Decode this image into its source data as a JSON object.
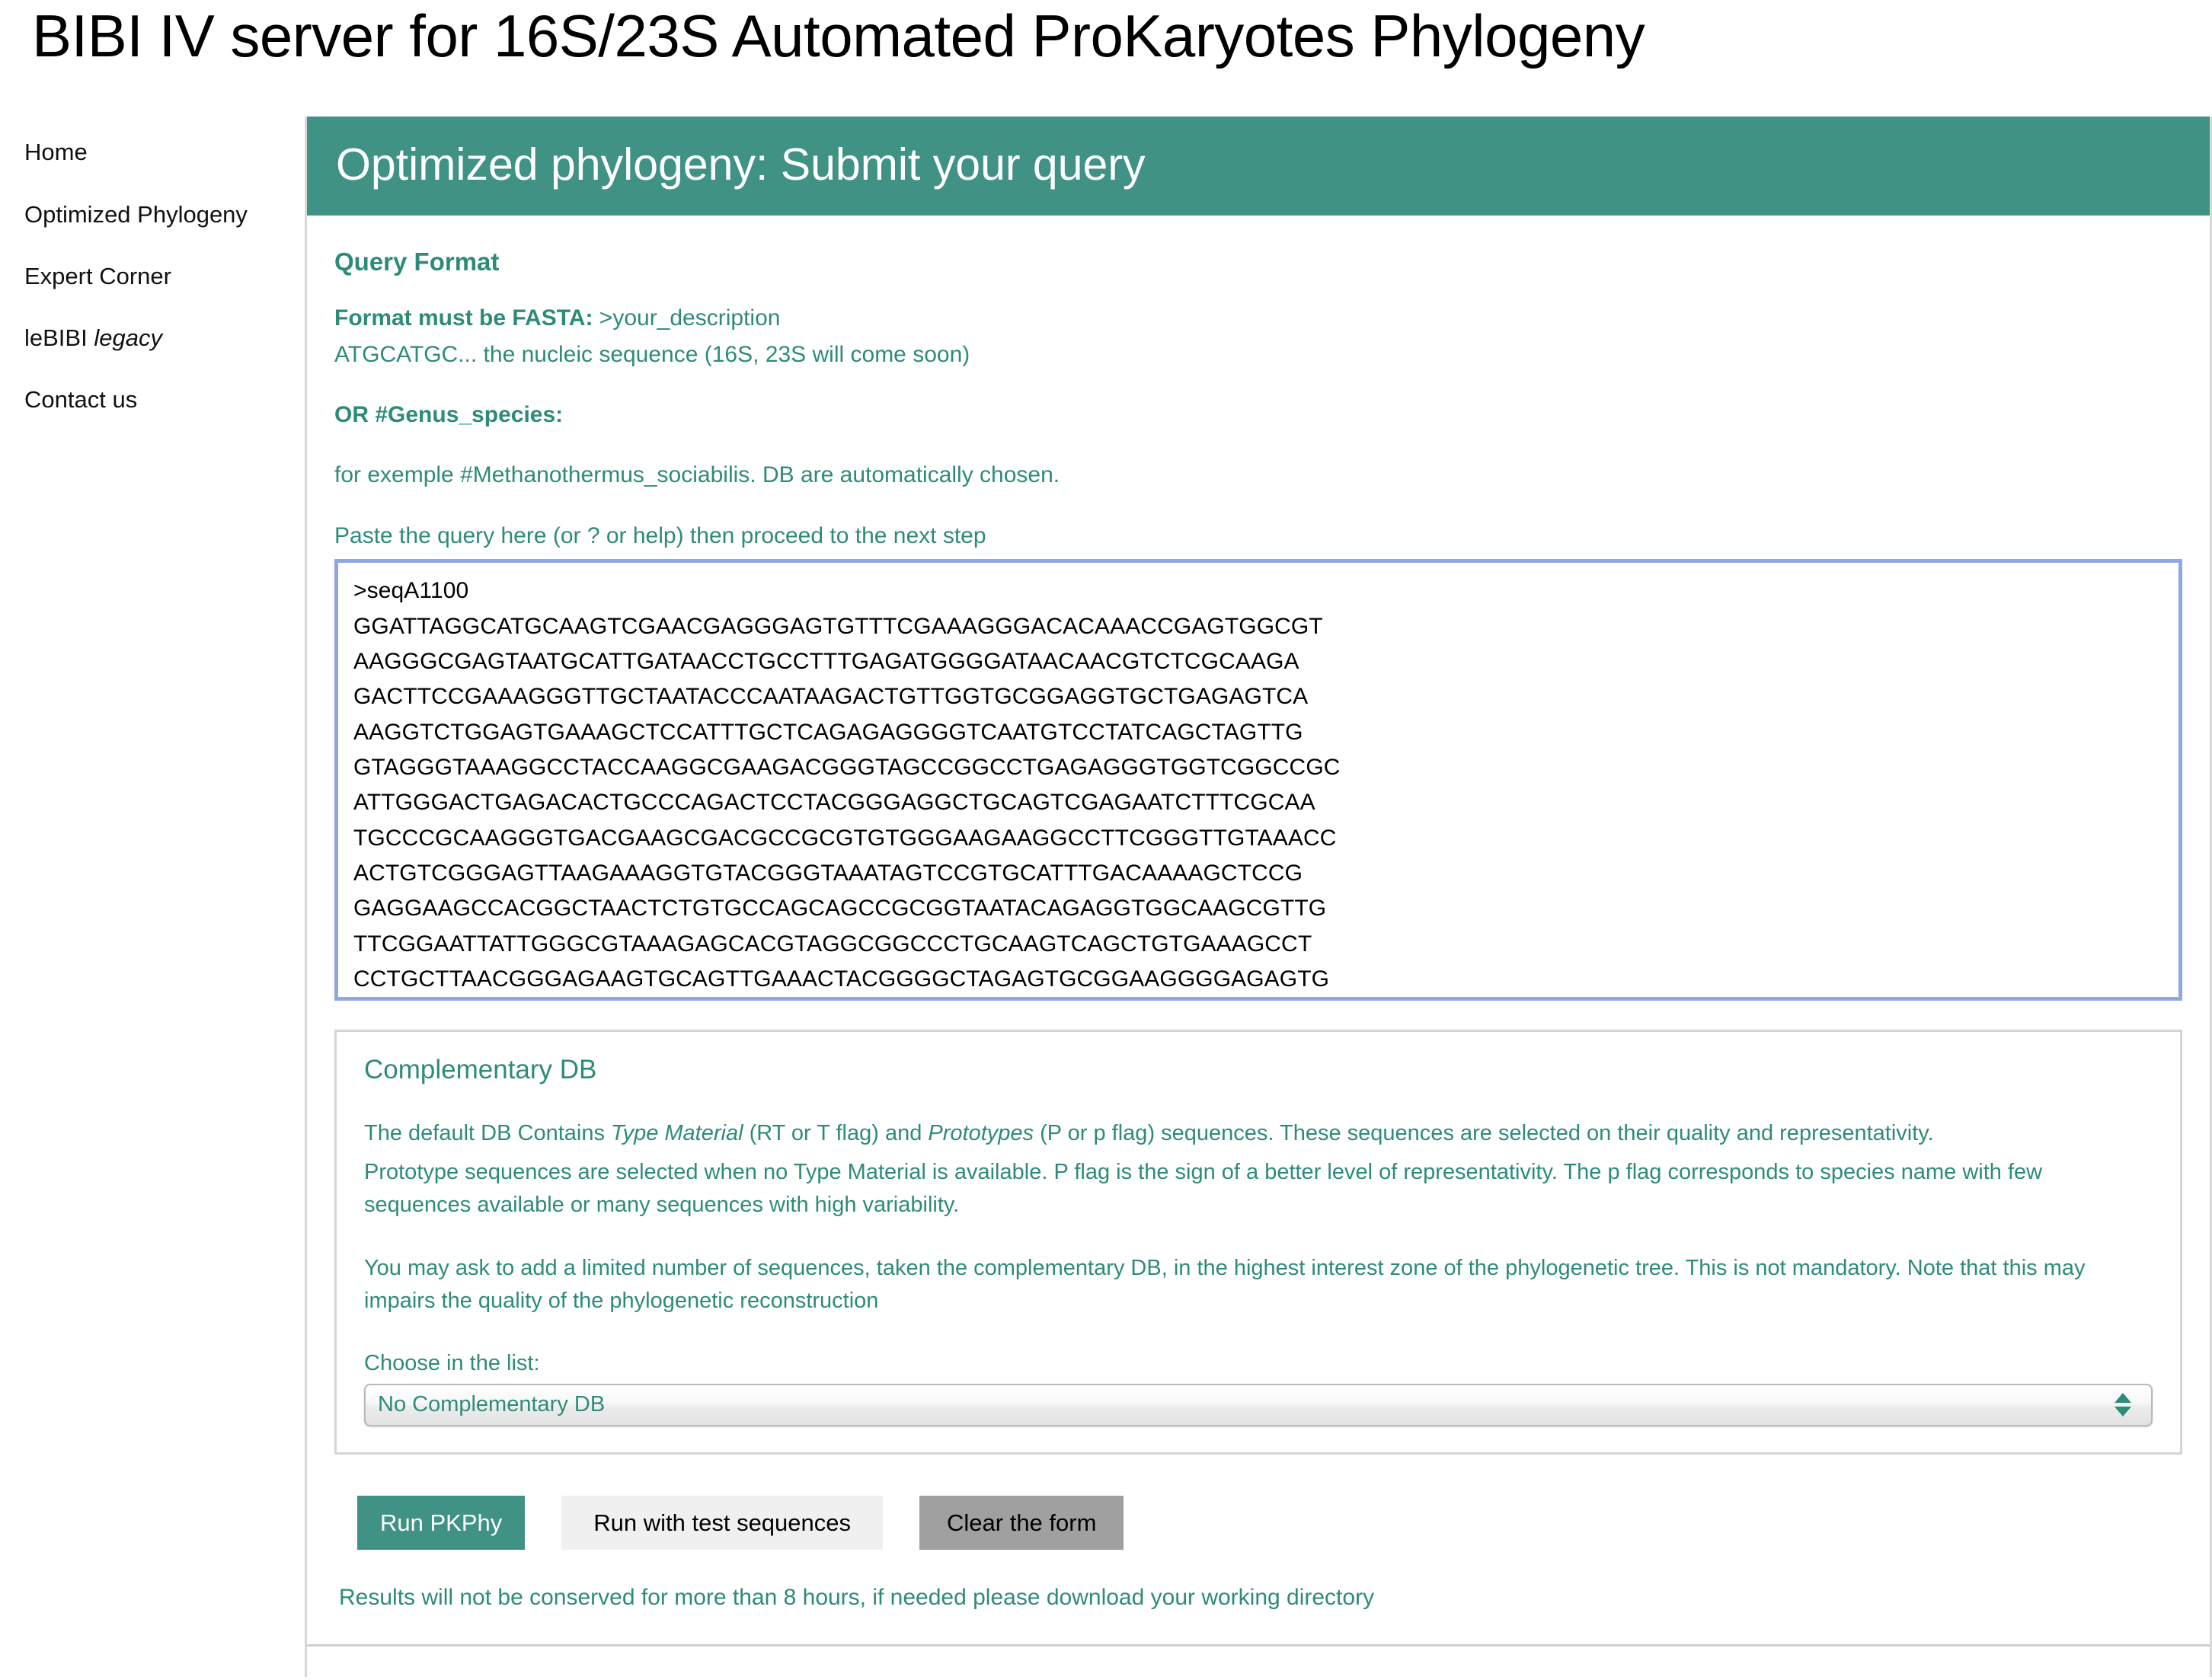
{
  "page": {
    "title": "BIBI IV server for 16S/23S Automated ProKaryotes Phylogeny"
  },
  "theme": {
    "teal": "#3f9284",
    "teal_text": "#2e8b79",
    "textarea_border": "#8fa8e0",
    "button_grey": "#a0a0a0",
    "button_light": "#f0f0f0"
  },
  "sidebar": {
    "items": [
      {
        "label": "Home",
        "italic_part": ""
      },
      {
        "label": "Optimized Phylogeny",
        "italic_part": ""
      },
      {
        "label": "Expert Corner",
        "italic_part": ""
      },
      {
        "label": "leBIBI ",
        "italic_part": "legacy"
      },
      {
        "label": "Contact us",
        "italic_part": ""
      }
    ],
    "item0_label": "Home",
    "item1_label": "Optimized Phylogeny",
    "item2_label": "Expert Corner",
    "item3_label": "leBIBI ",
    "item3_italic": "legacy",
    "item4_label": "Contact us"
  },
  "header": {
    "title": "Optimized phylogeny: Submit your query"
  },
  "query_format": {
    "heading": "Query Format",
    "fasta_label": "Format must be FASTA:",
    "fasta_value": " >your_description",
    "fasta_line2": "ATGCATGC... the nucleic sequence (16S, 23S will come soon)",
    "or_genus_heading": "OR #Genus_species:",
    "example_line": "for exemple #Methanothermus_sociabilis. DB are automatically chosen.",
    "paste_label": "Paste the query here (or ? or help) then proceed to the next step"
  },
  "query_input": {
    "value": ">seqA1100\nGGATTAGGCATGCAAGTCGAACGAGGGAGTGTTTCGAAAGGGACACAAACCGAGTGGCGT\nAAGGGCGAGTAATGCATTGATAACCTGCCTTTGAGATGGGGATAACAACGTCTCGCAAGA\nGACTTCCGAAAGGGTTGCTAATACCCAATAAGACTGTTGGTGCGGAGGTGCTGAGAGTCA\nAAGGTCTGGAGTGAAAGCTCCATTTGCTCAGAGAGGGGTCAATGTCCTATCAGCTAGTTG\nGTAGGGTAAAGGCCTACCAAGGCGAAGACGGGTAGCCGGCCTGAGAGGGTGGTCGGCCGC\nATTGGGACTGAGACACTGCCCAGACTCCTACGGGAGGCTGCAGTCGAGAATCTTTCGCAA\nTGCCCGCAAGGGTGACGAAGCGACGCCGCGTGTGGGAAGAAGGCCTTCGGGTTGTAAACC\nACTGTCGGGAGTTAAGAAAGGTGTACGGGTAAATAGTCCGTGCATTTGACAAAAGCTCCG\nGAGGAAGCCACGGCTAACTCTGTGCCAGCAGCCGCGGTAATACAGAGGTGGCAAGCGTTG\nTTCGGAATTATTGGGCGTAAAGAGCACGTAGGCGGCCCTGCAAGTCAGCTGTGAAAGCCT\nCCTGCTTAACGGGAGAAGTGCAGTTGAAACTACGGGGCTAGAGTGCGGAAGGGGAGAGTG",
    "placeholder": "Paste the query here"
  },
  "complementary_db": {
    "legend": "Complementary DB",
    "para1_a": "The default DB Contains ",
    "para1_em1": "Type Material",
    "para1_b": " (RT or T flag) and ",
    "para1_em2": "Prototypes",
    "para1_c": " (P or p flag) sequences. These sequences are selected on their quality and representativity.",
    "para2": "Prototype sequences are selected when no Type Material is available. P flag is the sign of a better level of representativity. The p flag corresponds to species name with few sequences available or many sequences with high variability.",
    "para3": "You may ask to add a limited number of sequences, taken the complementary DB, in the highest interest zone of the phylogenetic tree. This is not mandatory. Note that this may impairs the quality of the phylogenetic reconstruction",
    "choose_label": "Choose in the list:",
    "selected_option": "No Complementary DB",
    "options": [
      "No Complementary DB"
    ]
  },
  "buttons": {
    "run": "Run PKPhy",
    "test": "Run with test sequences",
    "clear": "Clear the form"
  },
  "footer": {
    "results_note": "Results will not be conserved for more than 8 hours, if needed please download your working directory"
  }
}
